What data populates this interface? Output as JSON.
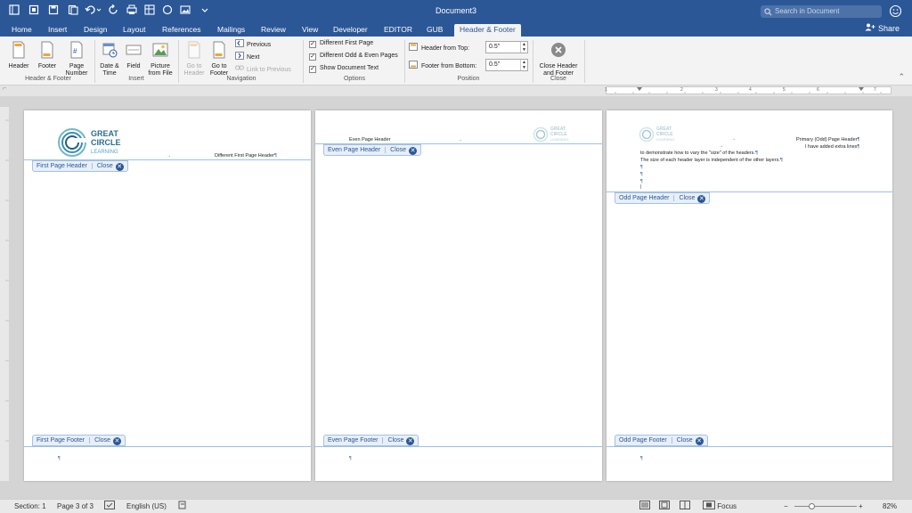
{
  "window": {
    "title": "Document3",
    "search_placeholder": "Search in Document"
  },
  "quick_access": {
    "icons": [
      "sidebar-icon",
      "home-icon",
      "save-icon",
      "undo-icon",
      "redo-icon",
      "print-icon",
      "table-icon",
      "circle-icon",
      "image-icon",
      "more-icon"
    ]
  },
  "tabs": [
    "Home",
    "Insert",
    "Design",
    "Layout",
    "References",
    "Mailings",
    "Review",
    "View",
    "Developer",
    "EDITOR",
    "GUB",
    "Header & Footer"
  ],
  "active_tab": "Header & Footer",
  "share_label": "Share",
  "ribbon": {
    "header_label": "Header",
    "footer_label": "Footer",
    "page_number_label1": "Page",
    "page_number_label2": "Number",
    "group_hf": "Header & Footer",
    "date_time1": "Date &",
    "date_time2": "Time",
    "field": "Field",
    "picture1": "Picture",
    "picture2": "from File",
    "group_insert": "Insert",
    "goto_header1": "Go to",
    "goto_header2": "Header",
    "goto_footer1": "Go to",
    "goto_footer2": "Footer",
    "previous": "Previous",
    "next": "Next",
    "link_prev": "Link to Previous",
    "group_nav": "Navigation",
    "opt_first": "Different First Page",
    "opt_oddeven": "Different Odd & Even Pages",
    "opt_show": "Show Document Text",
    "group_options": "Options",
    "header_top_label": "Header from Top:",
    "header_top_value": "0.5\"",
    "footer_bottom_label": "Footer from Bottom:",
    "footer_bottom_value": "0.5\"",
    "group_position": "Position",
    "close1": "Close Header",
    "close2": "and Footer",
    "group_close": "Close"
  },
  "ruler_numbers": [
    "1",
    "2",
    "3",
    "4",
    "5",
    "6",
    "7"
  ],
  "logo": {
    "line1": "GREAT",
    "line2": "CIRCLE",
    "line3": "LEARNING"
  },
  "pages": [
    {
      "header_text": "Different First Page Header",
      "header_tag": "First Page Header",
      "footer_tag": "First Page Footer",
      "close": "Close"
    },
    {
      "header_text": "Even Page Header",
      "header_tag": "Even Page Header",
      "footer_tag": "Even Page Footer",
      "close": "Close"
    },
    {
      "header_text": "Primary (Odd) Page Header",
      "extra_line": "I have added extra lines",
      "body1": "to demonstrate how to vary the \"size\" of the headers.",
      "body2": "The size of each header layer is independent of the other layers.",
      "header_tag": "Odd Page Header",
      "footer_tag": "Odd Page Footer",
      "close": "Close"
    }
  ],
  "status": {
    "section": "Section: 1",
    "page": "Page 3 of 3",
    "language": "English (US)",
    "focus": "Focus",
    "zoom": "82%"
  }
}
